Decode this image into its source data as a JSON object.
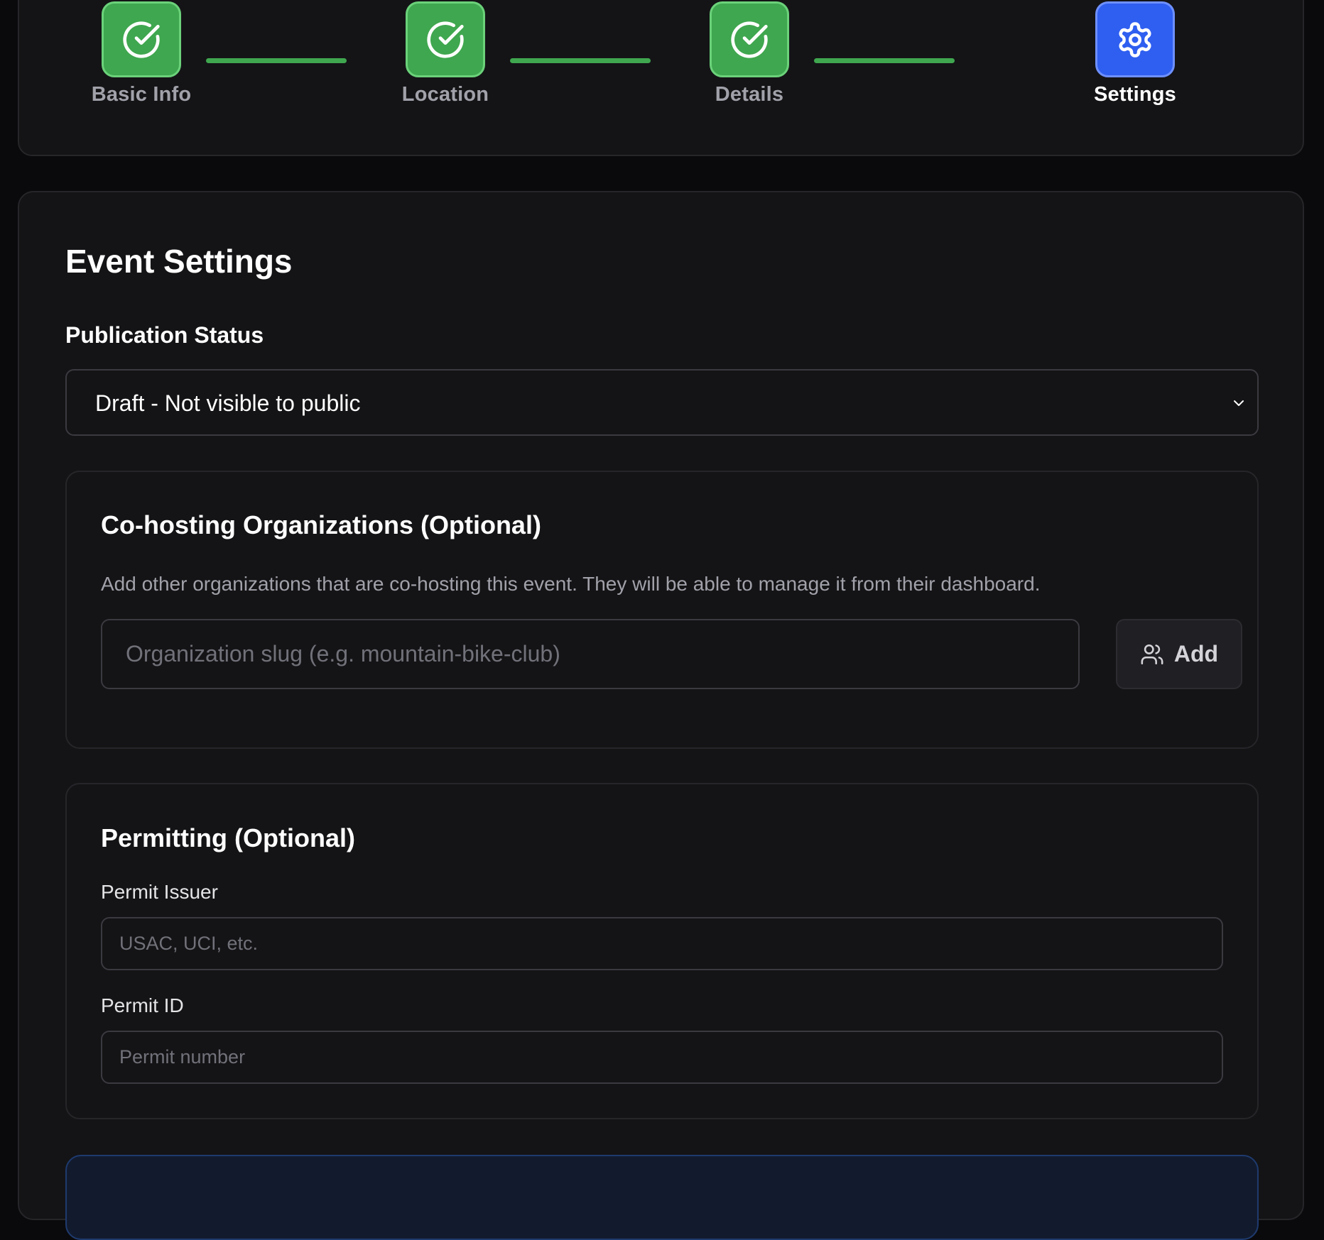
{
  "stepper": {
    "steps": [
      {
        "label": "Basic Info",
        "state": "complete",
        "icon": "check-circle-icon"
      },
      {
        "label": "Location",
        "state": "complete",
        "icon": "check-circle-icon"
      },
      {
        "label": "Details",
        "state": "complete",
        "icon": "check-circle-icon"
      },
      {
        "label": "Settings",
        "state": "active",
        "icon": "gear-icon"
      }
    ]
  },
  "colors": {
    "complete": "#3fa74f",
    "active": "#2f5ff0",
    "background": "#0a0a0c",
    "card": "#141416"
  },
  "settings": {
    "title": "Event Settings",
    "publication": {
      "label": "Publication Status",
      "selected": "Draft - Not visible to public"
    },
    "cohost": {
      "title": "Co-hosting Organizations (Optional)",
      "description": "Add other organizations that are co-hosting this event. They will be able to manage it from their dashboard.",
      "input_placeholder": "Organization slug (e.g. mountain-bike-club)",
      "add_label": "Add",
      "add_icon": "users-icon"
    },
    "permitting": {
      "title": "Permitting (Optional)",
      "issuer_label": "Permit Issuer",
      "issuer_placeholder": "USAC, UCI, etc.",
      "id_label": "Permit ID",
      "id_placeholder": "Permit number"
    }
  }
}
